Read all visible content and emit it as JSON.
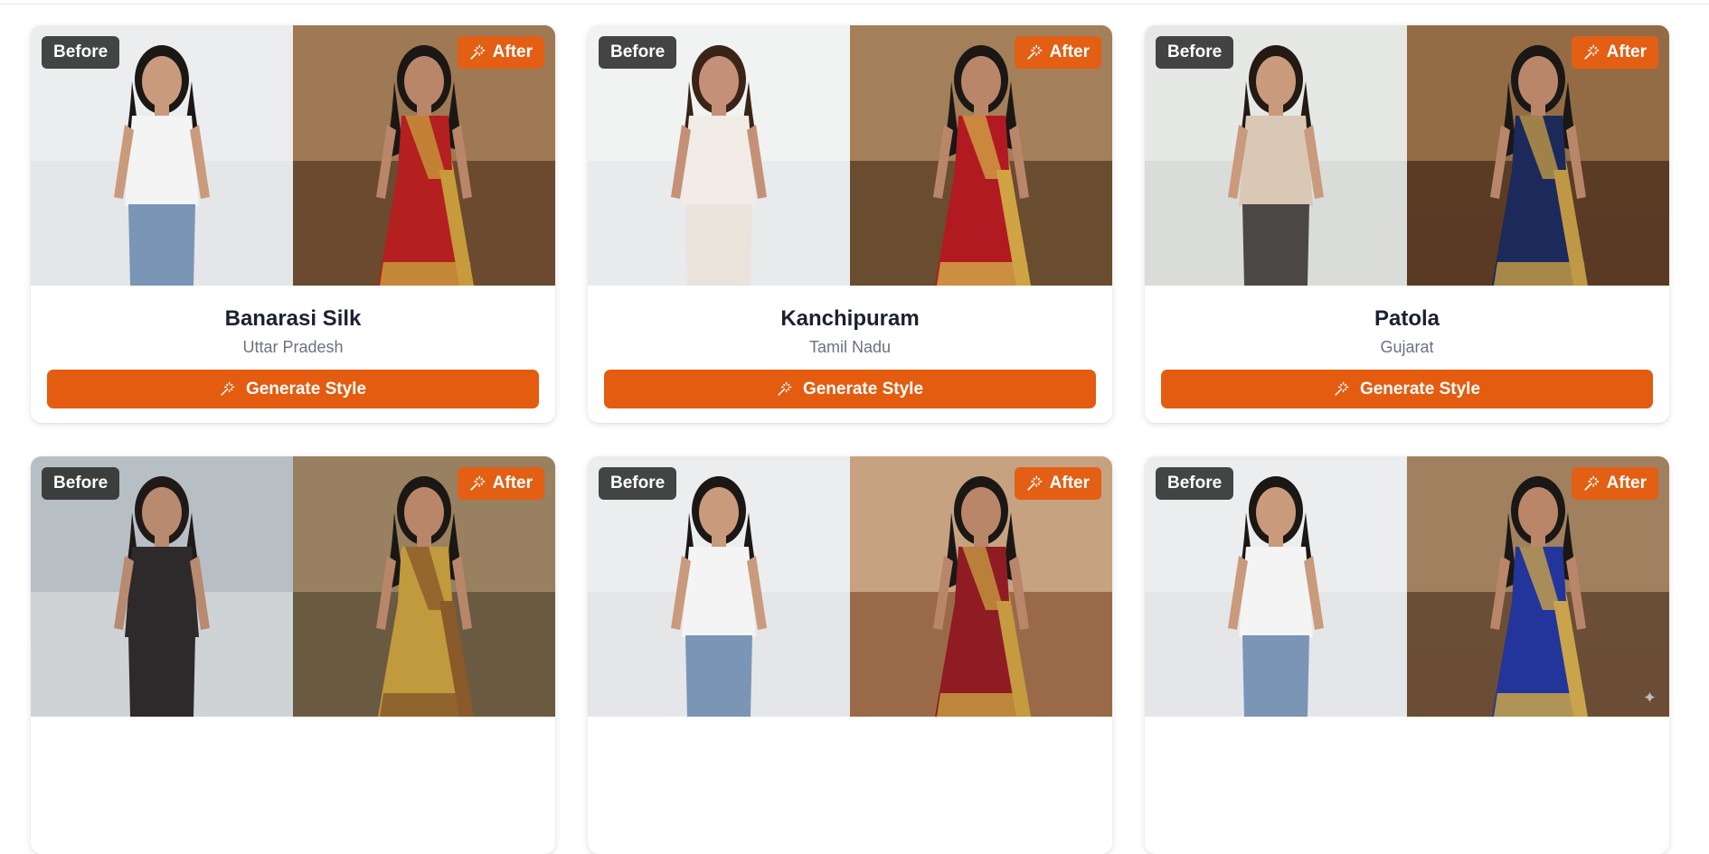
{
  "labels": {
    "before": "Before",
    "after": "After"
  },
  "cards": [
    {
      "title": "Banarasi Silk",
      "region": "Uttar Pradesh",
      "button": "Generate Style",
      "before": {
        "bg": "#e4e6e8",
        "top": "#f2f2f2",
        "hair": "#1b1715",
        "skin": "#c99a7c",
        "shirt": "#f4f4f4",
        "pants": "#7a95b6"
      },
      "after": {
        "bg": "#6b4a2f",
        "top": "#c29a6c",
        "hair": "#1b1715",
        "skin": "#b9866a",
        "saree": "#b3201f",
        "border": "#c79a3c"
      }
    },
    {
      "title": "Kanchipuram",
      "region": "Tamil Nadu",
      "button": "Generate Style",
      "before": {
        "bg": "#e9eaec",
        "top": "#f6f6f6",
        "hair": "#3a2417",
        "skin": "#c49178",
        "shirt": "#f1ece6",
        "pants": "#e9e3dc"
      },
      "after": {
        "bg": "#6a4c30",
        "top": "#c9a477",
        "hair": "#1b1715",
        "skin": "#b9866a",
        "saree": "#b21a22",
        "border": "#d0a345"
      }
    },
    {
      "title": "Patola",
      "region": "Gujarat",
      "button": "Generate Style",
      "before": {
        "bg": "#d9dcd9",
        "top": "#eef0ee",
        "hair": "#241a14",
        "skin": "#c99a7c",
        "shirt": "#d9c8b6",
        "pants": "#4b4744"
      },
      "after": {
        "bg": "#5a3b24",
        "top": "#b98d5e",
        "hair": "#1b1715",
        "skin": "#b9866a",
        "saree": "#1b2a5a",
        "border": "#bf9846"
      }
    },
    {
      "title": "",
      "region": "",
      "button": "",
      "before": {
        "bg": "#cfd3d6",
        "top": "#a9b3b8",
        "hair": "#1f1a17",
        "skin": "#b88a70",
        "shirt": "#2e2a2c",
        "pants": "#2e2a2c"
      },
      "after": {
        "bg": "#6b5a42",
        "top": "#b59a74",
        "hair": "#1b1715",
        "skin": "#b9866a",
        "saree": "#c19a3e",
        "border": "#8a5a2a"
      }
    },
    {
      "title": "",
      "region": "",
      "button": "",
      "before": {
        "bg": "#e4e6e8",
        "top": "#f2f2f2",
        "hair": "#1b1715",
        "skin": "#c99a7c",
        "shirt": "#f4f4f4",
        "pants": "#7a95b6"
      },
      "after": {
        "bg": "#9a6a48",
        "top": "#e5c8a8",
        "hair": "#1b1715",
        "skin": "#b9866a",
        "saree": "#8e1c22",
        "border": "#c59a40"
      }
    },
    {
      "title": "",
      "region": "",
      "button": "",
      "before": {
        "bg": "#e4e6e8",
        "top": "#f2f2f2",
        "hair": "#1b1715",
        "skin": "#c99a7c",
        "shirt": "#f4f4f4",
        "pants": "#7a95b6"
      },
      "after": {
        "bg": "#6a4e35",
        "top": "#c4a27a",
        "hair": "#1b1715",
        "skin": "#b9866a",
        "saree": "#23359a",
        "border": "#c9a44a"
      }
    }
  ]
}
